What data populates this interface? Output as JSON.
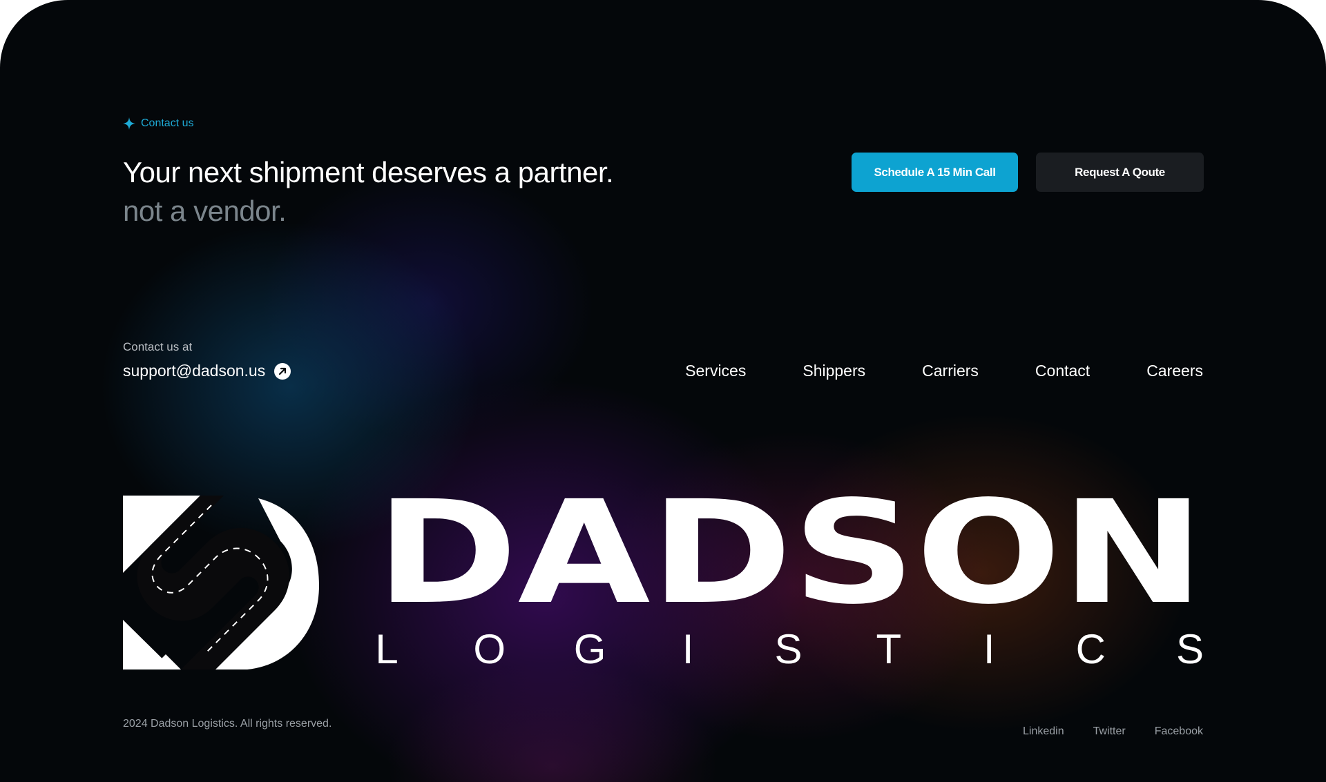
{
  "eyebrow": {
    "icon": "sparkle-icon",
    "label": "Contact us",
    "color": "#1eaad6"
  },
  "headline": {
    "line1": "Your next shipment deserves a partner.",
    "line2": "not a vendor."
  },
  "buttons": {
    "primary_label": "Schedule A 15 Min Call",
    "secondary_label": "Request A Qoute",
    "primary_color": "#0da3d1",
    "secondary_color": "#1a1d21"
  },
  "contact": {
    "label": "Contact us at",
    "email": "support@dadson.us",
    "icon": "external-link-arrow-icon"
  },
  "nav": {
    "items": [
      {
        "label": "Services"
      },
      {
        "label": "Shippers"
      },
      {
        "label": "Carriers"
      },
      {
        "label": "Contact"
      },
      {
        "label": "Careers"
      }
    ]
  },
  "logo": {
    "icon": "road-s-logo-icon",
    "wordmark": "DADSON",
    "tagline_letters": [
      "L",
      "O",
      "G",
      "I",
      "S",
      "T",
      "I",
      "C",
      "S"
    ]
  },
  "footer": {
    "copyright": "2024 Dadson Logistics. All rights reserved.",
    "social": [
      {
        "label": "Linkedin"
      },
      {
        "label": "Twitter"
      },
      {
        "label": "Facebook"
      }
    ]
  }
}
